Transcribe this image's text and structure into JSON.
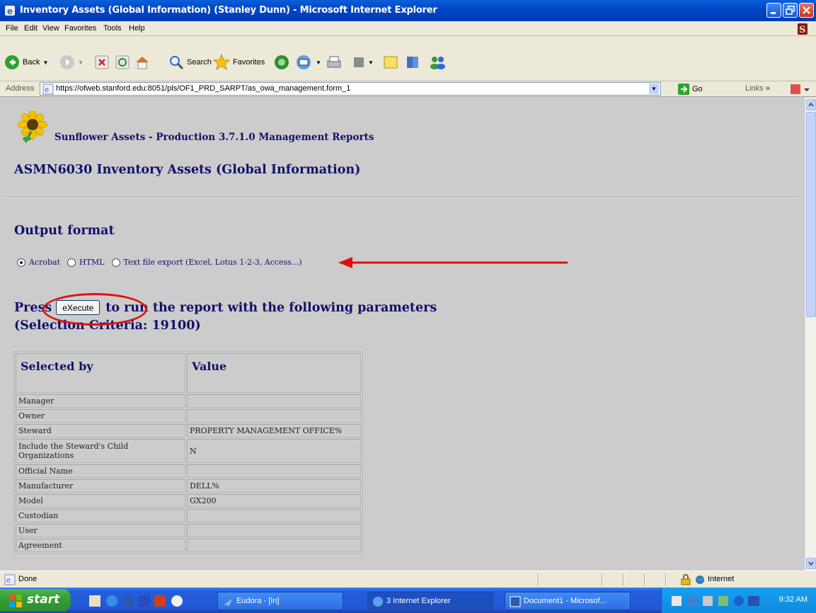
{
  "window": {
    "title": "Inventory Assets (Global Information) (Stanley Dunn) - Microsoft Internet Explorer"
  },
  "menu": [
    "File",
    "Edit",
    "View",
    "Favorites",
    "Tools",
    "Help"
  ],
  "toolbar": {
    "back": "Back",
    "search": "Search",
    "favorites": "Favorites"
  },
  "address": {
    "label": "Address",
    "url": "https://ofweb.stanford.edu:8051/pls/OF1_PRD_SARPT/as_owa_management.form_1",
    "go": "Go",
    "links": "Links"
  },
  "page": {
    "brand": "Sunflower Assets - Production 3.7.1.0 Management Reports",
    "title": "ASMN6030 Inventory Assets (Global Information)",
    "output_heading": "Output format",
    "options": [
      {
        "label": "Acrobat",
        "selected": true
      },
      {
        "label": "HTML",
        "selected": false
      },
      {
        "label": "Text file export (Excel, Lotus 1-2-3, Access...)",
        "selected": false
      }
    ],
    "press_prefix": "Press",
    "execute": "eXecute",
    "press_suffix": "to run the report with the following parameters",
    "criteria": "(Selection Criteria: 19100)",
    "table": {
      "headers": [
        "Selected by",
        "Value"
      ],
      "rows": [
        [
          "Manager",
          ""
        ],
        [
          "Owner",
          ""
        ],
        [
          "Steward",
          "PROPERTY MANAGEMENT OFFICE%"
        ],
        [
          "Include the Steward's Child Organizations",
          "N"
        ],
        [
          "Official Name",
          ""
        ],
        [
          "Manufacturer",
          "DELL%"
        ],
        [
          "Model",
          "GX200"
        ],
        [
          "Custodian",
          ""
        ],
        [
          "User",
          ""
        ],
        [
          "Agreement",
          ""
        ]
      ]
    }
  },
  "status": {
    "text": "Done",
    "zone": "Internet"
  },
  "taskbar": {
    "start": "start",
    "buttons": [
      "Eudora - [In]",
      "3 Internet Explorer",
      "Document1 - Microsof..."
    ],
    "clock": "9:32 AM"
  },
  "colors": {
    "heading": "#11116b",
    "annotation": "#e01010",
    "content_bg": "#cccccc"
  }
}
